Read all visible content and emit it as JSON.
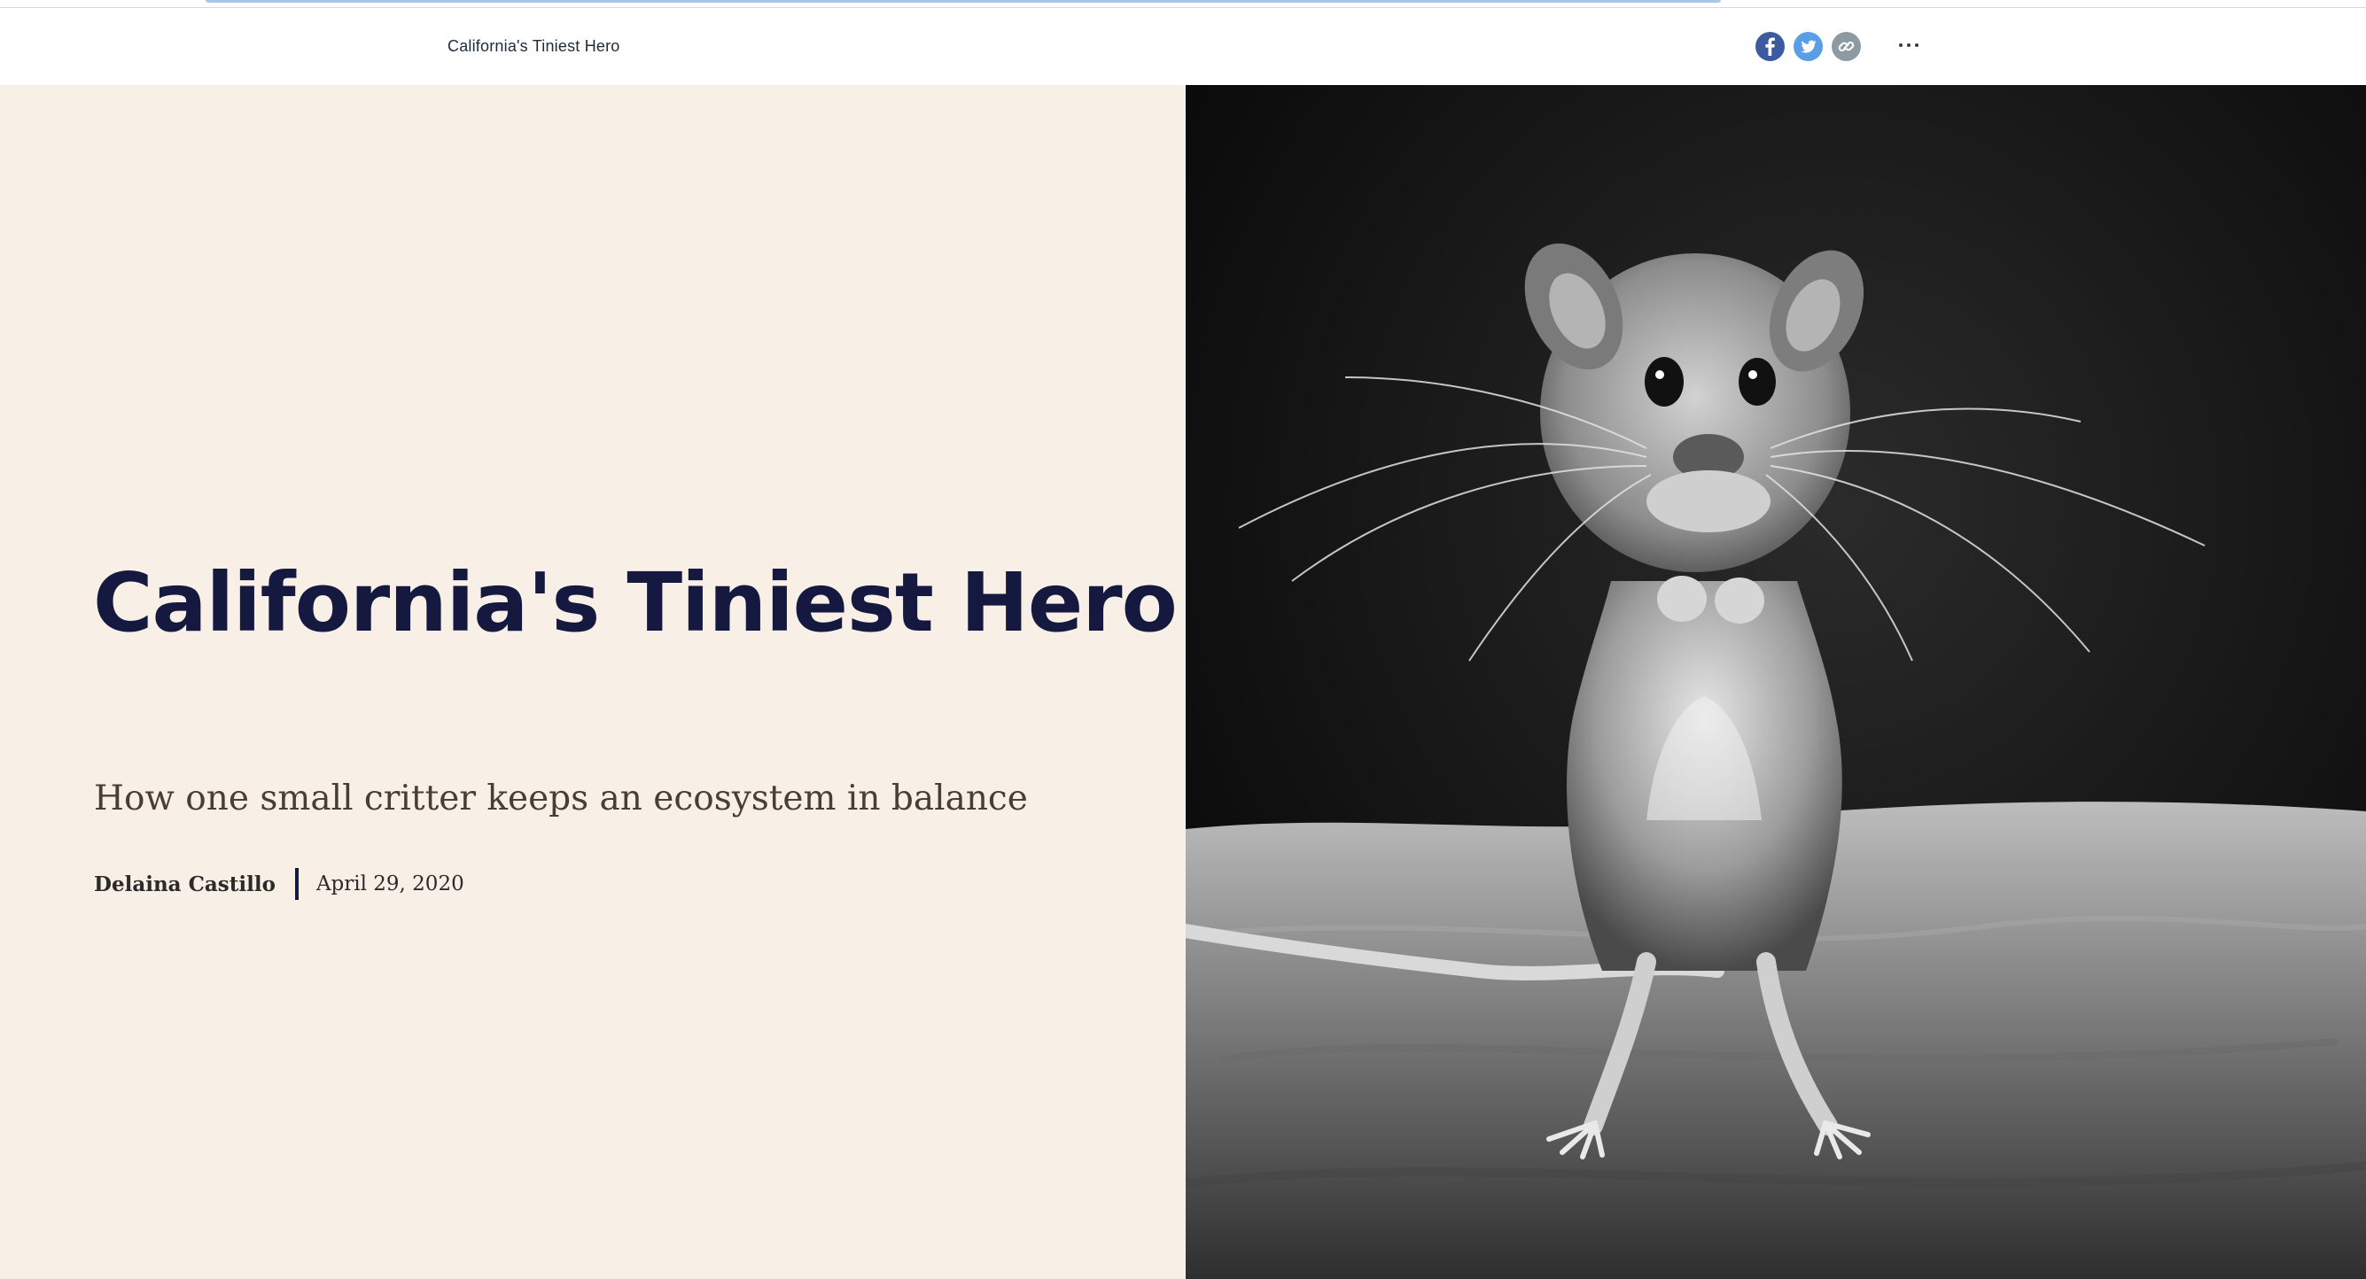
{
  "header": {
    "title": "California's Tiniest Hero",
    "share": {
      "facebook_icon": "facebook-icon",
      "twitter_icon": "twitter-icon",
      "link_icon": "link-icon"
    },
    "more_icon": "more-options-icon"
  },
  "hero": {
    "title": "California's Tiniest Hero",
    "subtitle": "How one small critter keeps an ecosystem in balance",
    "author": "Delaina Castillo",
    "date": "April 29, 2020",
    "image": "black-and-white photo of a kangaroo rat standing upright on sand"
  },
  "colors": {
    "title_navy": "#15193f",
    "left_panel_bg": "#f8f0e6",
    "facebook_blue": "#3b5aa0",
    "twitter_blue": "#5a9ee8",
    "link_gray": "#8e9aa1"
  }
}
